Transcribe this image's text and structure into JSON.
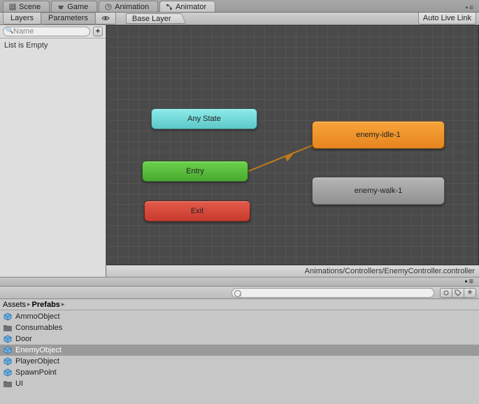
{
  "top_tabs": {
    "scene": "Scene",
    "game": "Game",
    "animation": "Animation",
    "animator": "Animator"
  },
  "animator": {
    "subtabs": {
      "layers": "Layers",
      "parameters": "Parameters"
    },
    "search_placeholder": "Name",
    "breadcrumb": "Base Layer",
    "auto_live_link": "Auto Live Link",
    "empty_msg": "List is Empty",
    "footer_path": "Animations/Controllers/EnemyController.controller",
    "nodes": {
      "any_state": "Any State",
      "entry": "Entry",
      "exit": "Exit",
      "idle": "enemy-idle-1",
      "walk": "enemy-walk-1"
    }
  },
  "project": {
    "crumbs": [
      "Assets",
      "Prefabs"
    ],
    "items": [
      {
        "name": "AmmoObject",
        "icon": "prefab",
        "selected": false
      },
      {
        "name": "Consumables",
        "icon": "folder",
        "selected": false
      },
      {
        "name": "Door",
        "icon": "prefab",
        "selected": false
      },
      {
        "name": "EnemyObject",
        "icon": "prefab",
        "selected": true
      },
      {
        "name": "PlayerObject",
        "icon": "prefab",
        "selected": false
      },
      {
        "name": "SpawnPoint",
        "icon": "prefab",
        "selected": false
      },
      {
        "name": "UI",
        "icon": "folder",
        "selected": false
      }
    ]
  }
}
